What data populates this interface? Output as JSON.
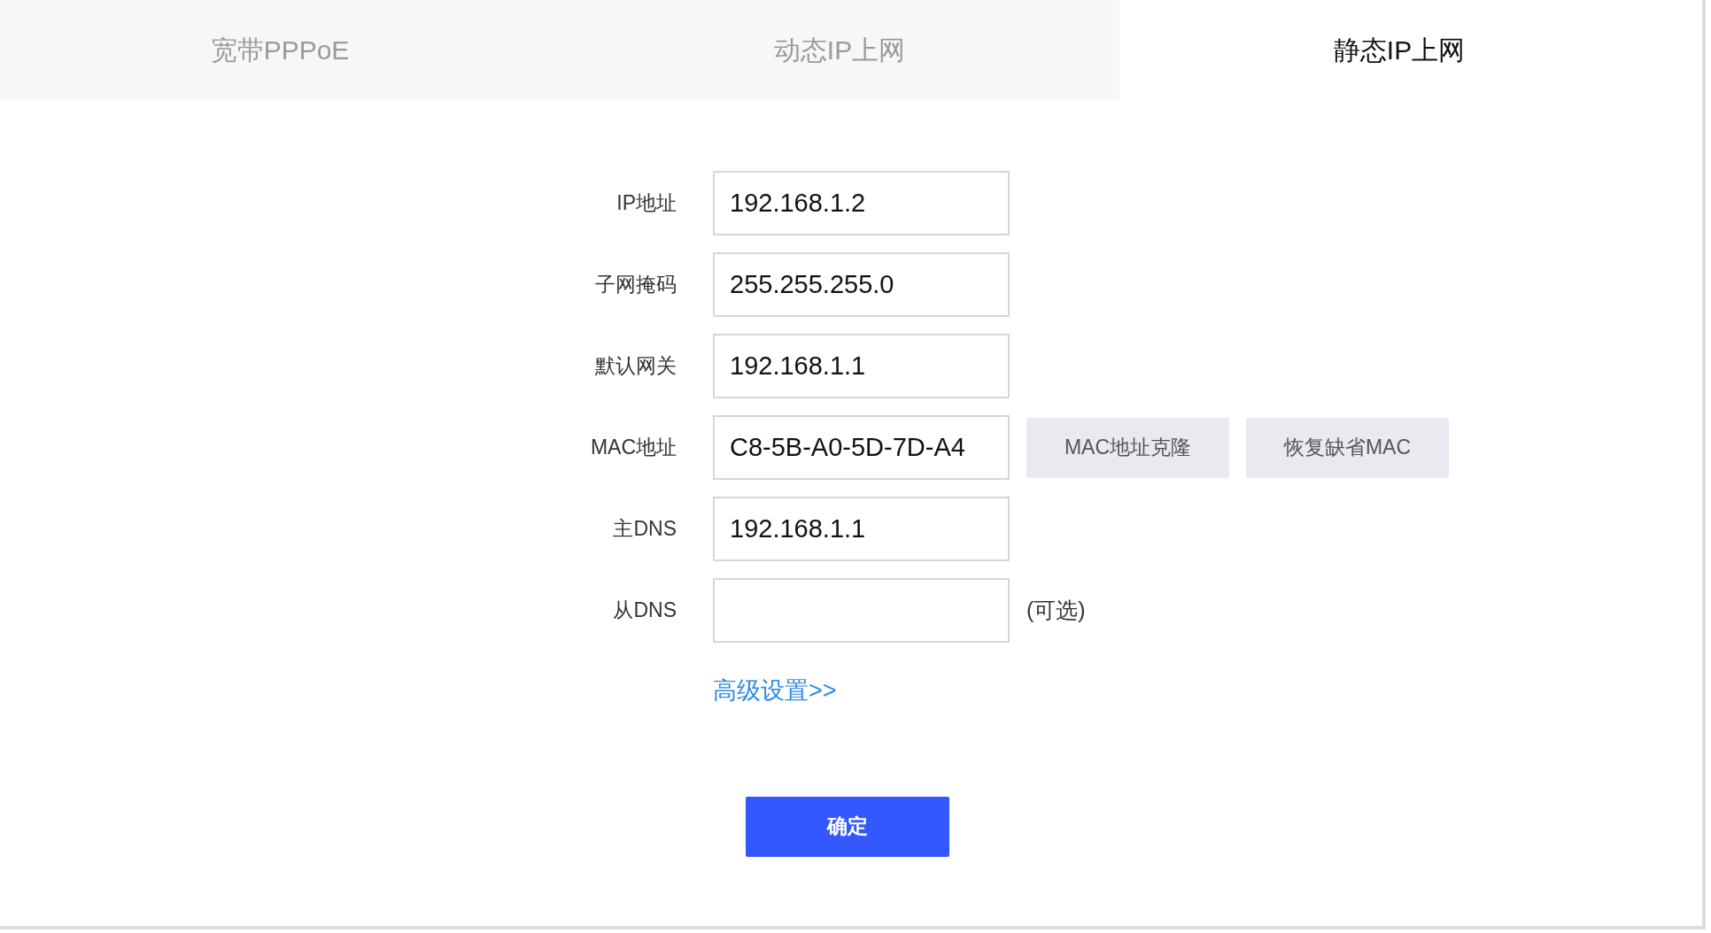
{
  "tabs": [
    {
      "label": "宽带PPPoE",
      "selected": false
    },
    {
      "label": "动态IP上网",
      "selected": false
    },
    {
      "label": "静态IP上网",
      "selected": true
    }
  ],
  "fields": [
    {
      "label": "IP地址",
      "value": "192.168.1.2"
    },
    {
      "label": "子网掩码",
      "value": "255.255.255.0"
    },
    {
      "label": "默认网关",
      "value": "192.168.1.1"
    },
    {
      "label": "MAC地址",
      "value": "C8-5B-A0-5D-7D-A4",
      "buttons": [
        "MAC地址克隆",
        "恢复缺省MAC"
      ]
    },
    {
      "label": "主DNS",
      "value": "192.168.1.1"
    },
    {
      "label": "从DNS",
      "note": "(可选)"
    }
  ],
  "advanced_link": "高级设置>>",
  "confirm_button": "确定"
}
